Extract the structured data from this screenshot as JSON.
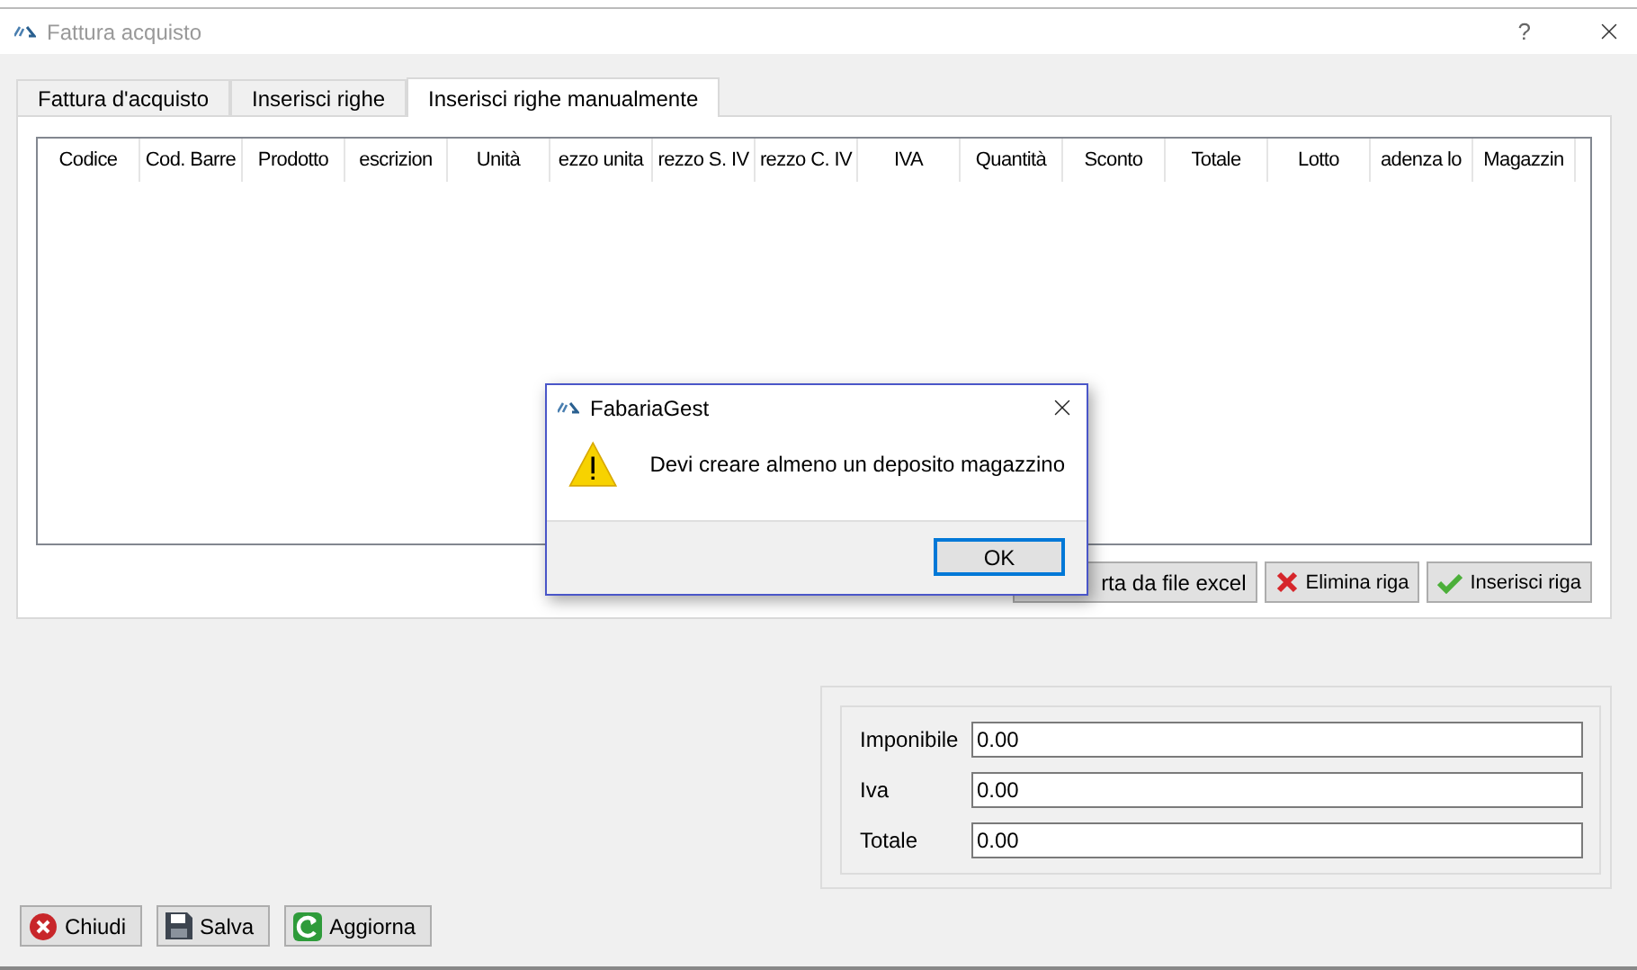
{
  "window": {
    "title": "Fattura acquisto",
    "help": "?"
  },
  "tabs": [
    {
      "label": "Fattura d'acquisto",
      "selected": false
    },
    {
      "label": "Inserisci righe",
      "selected": false
    },
    {
      "label": "Inserisci righe manualmente",
      "selected": true
    }
  ],
  "table": {
    "columns": [
      "Codice",
      "Cod. Barre",
      "Prodotto",
      "escrizion",
      "Unità",
      "ezzo unita",
      "rezzo S. IV",
      "rezzo C. IV",
      "IVA",
      "Quantità",
      "Sconto",
      "Totale",
      "Lotto",
      "adenza lo",
      "Magazzin"
    ]
  },
  "row_buttons": [
    {
      "label": "rta da file excel",
      "kind": "import"
    },
    {
      "label": "Elimina riga",
      "kind": "delete"
    },
    {
      "label": "Inserisci riga",
      "kind": "add"
    }
  ],
  "totals": [
    {
      "label": "Imponibile",
      "value": "0.00"
    },
    {
      "label": "Iva",
      "value": "0.00"
    },
    {
      "label": "Totale",
      "value": "0.00"
    }
  ],
  "footer_buttons": [
    {
      "label": "Chiudi",
      "kind": "close"
    },
    {
      "label": "Salva",
      "kind": "save"
    },
    {
      "label": "Aggiorna",
      "kind": "refresh"
    }
  ],
  "dialog": {
    "title": "FabariaGest",
    "message": "Devi creare almeno un deposito magazzino",
    "button": "OK"
  }
}
